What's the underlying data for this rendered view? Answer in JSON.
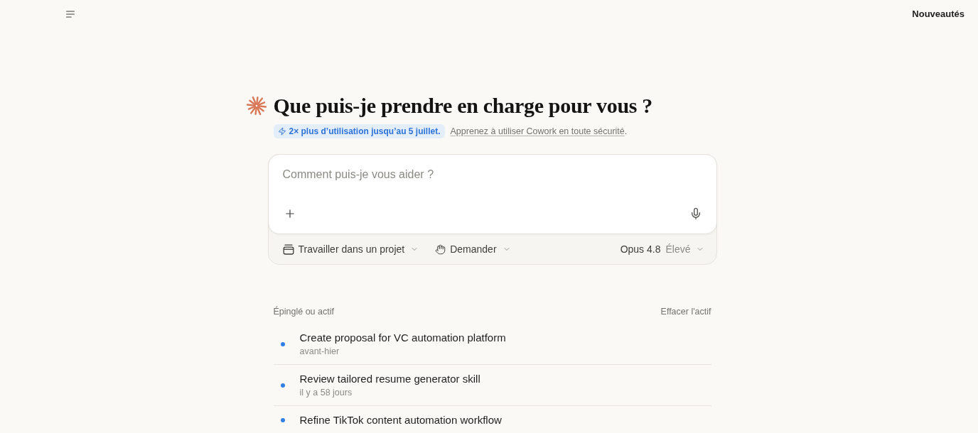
{
  "top_bar": {
    "whats_new": "Nouveautés"
  },
  "heading": {
    "title": "Que puis-je prendre en charge pour vous ?"
  },
  "promo": {
    "badge": "2× plus d’utilisation jusqu’au 5 juillet.",
    "link": "Apprenez à utiliser Cowork en toute sécurité",
    "link_suffix": "."
  },
  "composer": {
    "placeholder": "Comment puis-je vous aider ?",
    "project_button": "Travailler dans un projet",
    "mode_button": "Demander",
    "model": "Opus 4.8",
    "effort": "Élevé"
  },
  "recents": {
    "title": "Épinglé ou actif",
    "clear": "Effacer l'actif",
    "items": [
      {
        "title": "Create proposal for VC automation platform",
        "time": "avant-hier",
        "active": true
      },
      {
        "title": "Review tailored resume generator skill",
        "time": "il y a 58 jours",
        "active": true
      },
      {
        "title": "Refine TikTok content automation workflow",
        "active": true
      }
    ]
  }
}
